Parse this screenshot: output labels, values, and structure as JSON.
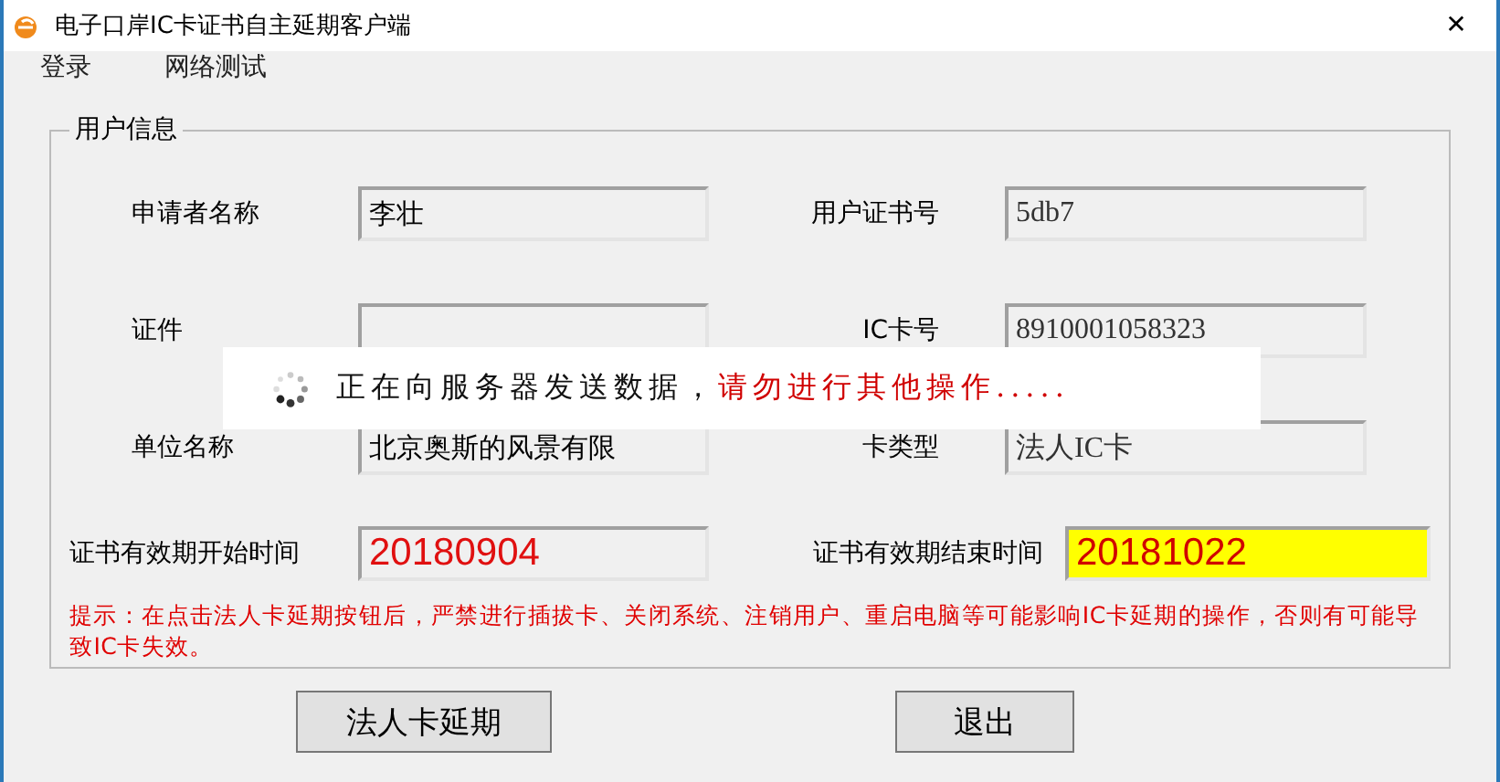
{
  "window": {
    "title": "电子口岸IC卡证书自主延期客户端",
    "close": "✕"
  },
  "menu": [
    {
      "label": "登录"
    },
    {
      "label": "网络测试"
    }
  ],
  "group": {
    "title": "用户信息",
    "rows": [
      {
        "left": {
          "label": "申请者名称",
          "value": "李壮"
        },
        "right": {
          "label": "用户证书号",
          "value": "5db7"
        }
      },
      {
        "left": {
          "label": "证件"
        },
        "right": {
          "label": "IC卡号",
          "value": "8910001058323"
        }
      },
      {
        "left": {
          "label": "单位名称",
          "value": "北京奥斯的风景有限"
        },
        "right": {
          "label": "卡类型",
          "value": "法人IC卡"
        }
      }
    ],
    "dates": [
      {
        "label": "证书有效期开始时间",
        "value": "20180904",
        "highlighted": false
      },
      {
        "label": "证书有效期结束时间",
        "value": "20181022",
        "highlighted": true
      }
    ],
    "notice": "提示：在点击法人卡延期按钮后，严禁进行插拔卡、关闭系统、注销用户、重启电脑等可能影响IC卡延期的操作，否则有可能导致IC卡失效。"
  },
  "buttons": [
    {
      "label": "法人卡延期"
    },
    {
      "label": "退出"
    }
  ],
  "overlay": {
    "message": "正在向服务器发送数据，",
    "warning": "请勿进行其他操作....."
  }
}
